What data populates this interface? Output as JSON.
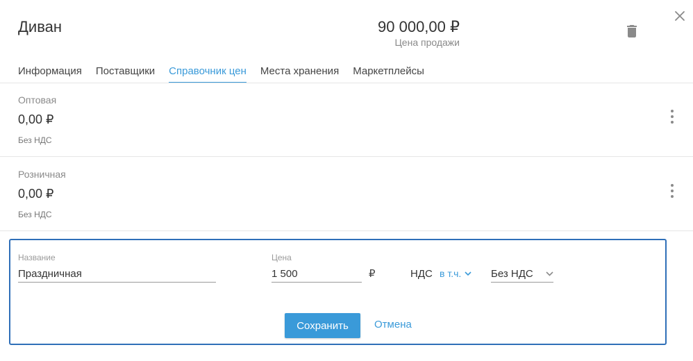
{
  "product": {
    "title": "Диван",
    "price": "90 000,00 ₽",
    "price_caption": "Цена продажи"
  },
  "icons": {
    "close": "close-icon",
    "delete": "trash-icon",
    "menu": "more-vertical-icon",
    "dropdown": "chevron-down-icon"
  },
  "colors": {
    "accent": "#3a9ad9",
    "form_border": "#2f6fb8",
    "muted_text": "#8a8a8a"
  },
  "tabs": [
    {
      "label": "Информация",
      "active": false
    },
    {
      "label": "Поставщики",
      "active": false
    },
    {
      "label": "Справочник цен",
      "active": true
    },
    {
      "label": "Места хранения",
      "active": false
    },
    {
      "label": "Маркетплейсы",
      "active": false
    }
  ],
  "price_list": [
    {
      "name": "Оптовая",
      "value": "0,00 ₽",
      "vat": "Без НДС"
    },
    {
      "name": "Розничная",
      "value": "0,00 ₽",
      "vat": "Без НДС"
    }
  ],
  "form": {
    "name_label": "Название",
    "name_value": "Праздничная",
    "price_label": "Цена",
    "price_value": "1 500",
    "currency": "₽",
    "vat_label": "НДС",
    "vat_mode": "в т.ч.",
    "vat_rate": "Без НДС",
    "save_label": "Сохранить",
    "cancel_label": "Отмена"
  }
}
